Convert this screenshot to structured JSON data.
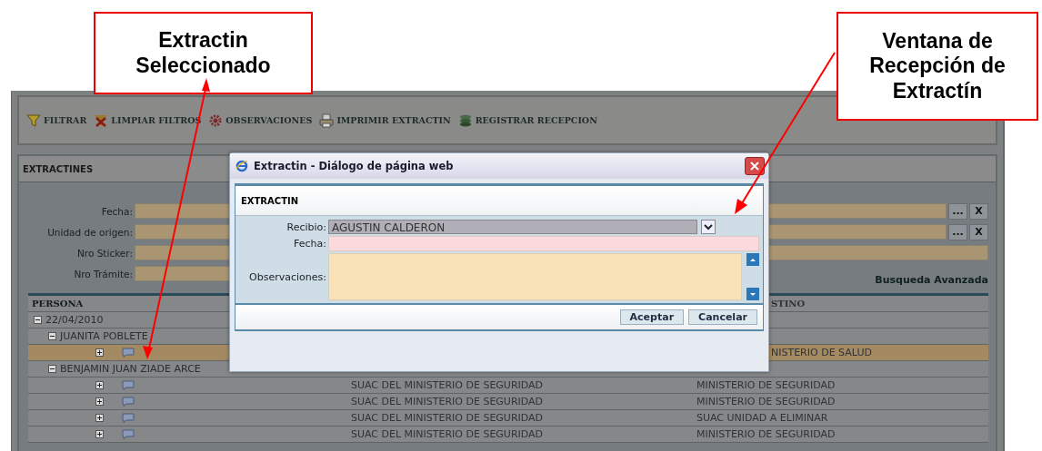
{
  "callouts": [
    {
      "text": "Extractin Seleccionado"
    },
    {
      "text": "Ventana de Recepción de Extractín"
    }
  ],
  "toolbar": [
    {
      "label": "FILTRAR",
      "kind": "filter"
    },
    {
      "label": "LIMPIAR FILTROS",
      "kind": "clear"
    },
    {
      "label": "OBSERVACIONES",
      "kind": "gear"
    },
    {
      "label": "IMPRIMIR EXTRACTIN",
      "kind": "print"
    },
    {
      "label": "REGISTRAR RECEPCION",
      "kind": "register"
    }
  ],
  "panel": {
    "title": "EXTRACTINES",
    "filters": [
      {
        "label": "Fecha:",
        "kind": "picker",
        "buttons": [
          "...",
          "X"
        ]
      },
      {
        "label": "Unidad de origen:",
        "kind": "picker",
        "buttons": [
          "...",
          "X"
        ]
      },
      {
        "label": "Nro Sticker:",
        "kind": "text"
      },
      {
        "label": "Nro Trámite:",
        "kind": "short"
      }
    ],
    "advanced_search": "Busqueda Avanzada",
    "table": {
      "columns": {
        "persona": "PERSONA",
        "destination": "STINO"
      },
      "tree": [
        {
          "label": "22/04/2010",
          "expanded": true,
          "children": [
            {
              "label": "JUANITA POBLETE",
              "expanded": true,
              "children": [
                {
                  "selected": true,
                  "expanded": false,
                  "destination": "NISTERIO DE SALUD"
                }
              ]
            },
            {
              "label": "BENJAMIN JUAN ZIADE ARCE",
              "expanded": true,
              "children": [
                {
                  "selected": false,
                  "expanded": false,
                  "origin": "SUAC DEL MINISTERIO DE SEGURIDAD",
                  "destination": "MINISTERIO DE SEGURIDAD"
                },
                {
                  "selected": false,
                  "expanded": false,
                  "origin": "SUAC DEL MINISTERIO DE SEGURIDAD",
                  "destination": "MINISTERIO DE SEGURIDAD"
                },
                {
                  "selected": false,
                  "expanded": false,
                  "origin": "SUAC DEL MINISTERIO DE SEGURIDAD",
                  "destination": "SUAC UNIDAD A ELIMINAR"
                },
                {
                  "selected": false,
                  "expanded": false,
                  "origin": "SUAC DEL MINISTERIO DE SEGURIDAD",
                  "destination": "MINISTERIO DE SEGURIDAD"
                }
              ]
            }
          ]
        }
      ]
    }
  },
  "dialog": {
    "title": "Extractin - Diálogo de página web",
    "section": "EXTRACTIN",
    "fields": [
      {
        "label": "Recibio:",
        "kind": "select",
        "value": "AGUSTIN CALDERON"
      },
      {
        "label": "Fecha:",
        "kind": "text"
      },
      {
        "label": "Observaciones:",
        "kind": "textarea"
      }
    ],
    "buttons": [
      "Aceptar",
      "Cancelar"
    ]
  }
}
